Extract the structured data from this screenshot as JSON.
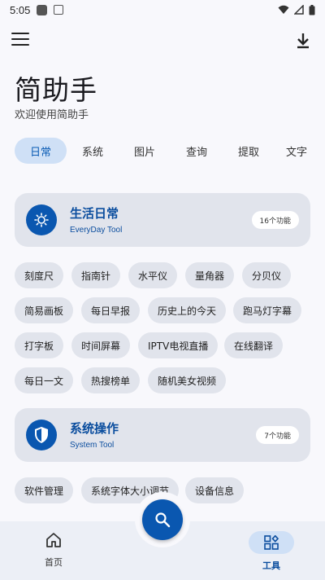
{
  "status_bar": {
    "time": "5:05"
  },
  "header": {
    "title": "简助手",
    "subtitle": "欢迎使用简助手"
  },
  "tabs": [
    {
      "label": "日常",
      "active": true
    },
    {
      "label": "系统"
    },
    {
      "label": "图片"
    },
    {
      "label": "查询"
    },
    {
      "label": "提取"
    },
    {
      "label": "文字"
    }
  ],
  "sections": [
    {
      "name": "生活日常",
      "subtitle": "EveryDay Tool",
      "count_badge": "16个功能",
      "icon": "sun-gear-icon",
      "items": [
        "刻度尺",
        "指南针",
        "水平仪",
        "量角器",
        "分贝仪",
        "简易画板",
        "每日早报",
        "历史上的今天",
        "跑马灯字幕",
        "打字板",
        "时间屏幕",
        "IPTV电视直播",
        "在线翻译",
        "每日一文",
        "热搜榜单",
        "随机美女视频"
      ]
    },
    {
      "name": "系统操作",
      "subtitle": "System Tool",
      "count_badge": "7个功能",
      "icon": "shield-icon",
      "items": [
        "软件管理",
        "系统字体大小调节",
        "设备信息"
      ]
    }
  ],
  "bottom_nav": {
    "home_label": "首页",
    "tools_label": "工具"
  },
  "colors": {
    "accent": "#0a57b0",
    "tab_active_bg": "#cfe0f6",
    "card_bg": "#e1e4ec",
    "page_bg": "#f8f8fc"
  }
}
